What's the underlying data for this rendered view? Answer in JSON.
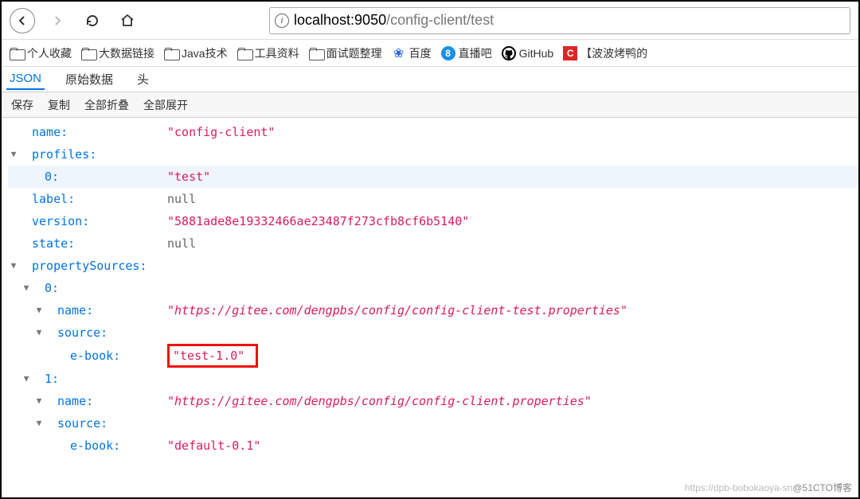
{
  "nav": {
    "url_host": "localhost:9050",
    "url_path": "/config-client/test"
  },
  "bookmarks": [
    {
      "icon": "folder",
      "label": "个人收藏"
    },
    {
      "icon": "folder",
      "label": "大数据链接"
    },
    {
      "icon": "folder",
      "label": "Java技术"
    },
    {
      "icon": "folder",
      "label": "工具资料"
    },
    {
      "icon": "folder",
      "label": "面试题整理"
    },
    {
      "icon": "baidu",
      "label": "百度"
    },
    {
      "icon": "zhibo",
      "label": "直播吧"
    },
    {
      "icon": "github",
      "label": "GitHub"
    },
    {
      "icon": "c",
      "label": "【波波烤鸭的"
    }
  ],
  "tabs": {
    "json": "JSON",
    "raw": "原始数据",
    "headers": "头"
  },
  "actions": {
    "save": "保存",
    "copy": "复制",
    "collapse": "全部折叠",
    "expand": "全部展开"
  },
  "json": {
    "k_name": "name:",
    "v_name": "\"config-client\"",
    "k_profiles": "profiles:",
    "k_p0": "0:",
    "v_p0": "\"test\"",
    "k_label": "label:",
    "v_label": "null",
    "k_version": "version:",
    "v_version": "\"5881ade8e19332466ae23487f273cfb8cf6b5140\"",
    "k_state": "state:",
    "v_state": "null",
    "k_ps": "propertySources:",
    "k_ps0": "0:",
    "k_ps0_name": "name:",
    "v_ps0_name": "\"https://gitee.com/dengpbs/config/config-client-test.properties\"",
    "k_ps0_src": "source:",
    "k_ps0_eb": "e-book:",
    "v_ps0_eb": "\"test-1.0\"",
    "k_ps1": "1:",
    "k_ps1_name": "name:",
    "v_ps1_name": "\"https://gitee.com/dengpbs/config/config-client.properties\"",
    "k_ps1_src": "source:",
    "k_ps1_eb": "e-book:",
    "v_ps1_eb": "\"default-0.1\""
  },
  "watermark": {
    "light": "https://dpb-bobokaoya-sn",
    "dark": "@51CTO博客"
  }
}
